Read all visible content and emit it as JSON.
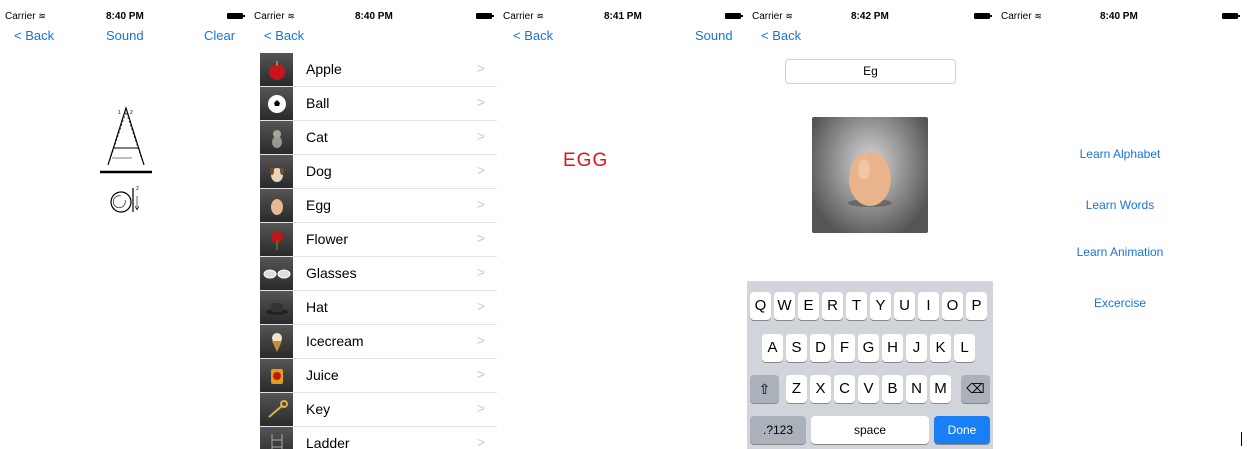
{
  "screens": [
    {
      "status": {
        "carrier": "Carrier",
        "time": "8:40 PM"
      },
      "nav": {
        "back": "< Back",
        "sound": "Sound",
        "clear": "Clear"
      }
    },
    {
      "status": {
        "carrier": "Carrier",
        "time": "8:40 PM"
      },
      "nav": {
        "back": "< Back"
      },
      "list": [
        "Apple",
        "Ball",
        "Cat",
        "Dog",
        "Egg",
        "Flower",
        "Glasses",
        "Hat",
        "Icecream",
        "Juice",
        "Key",
        "Ladder"
      ],
      "chevron": ">"
    },
    {
      "status": {
        "carrier": "Carrier",
        "time": "8:41 PM"
      },
      "nav": {
        "back": "< Back",
        "sound": "Sound"
      },
      "word": "EGG"
    },
    {
      "status": {
        "carrier": "Carrier",
        "time": "8:42 PM"
      },
      "nav": {
        "back": "< Back"
      },
      "input_value": "Eg",
      "keyboard": {
        "row1": [
          "Q",
          "W",
          "E",
          "R",
          "T",
          "Y",
          "U",
          "I",
          "O",
          "P"
        ],
        "row2": [
          "A",
          "S",
          "D",
          "F",
          "G",
          "H",
          "J",
          "K",
          "L"
        ],
        "row3": [
          "Z",
          "X",
          "C",
          "V",
          "B",
          "N",
          "M"
        ],
        "numbers": ".?123",
        "space": "space",
        "done": "Done"
      }
    },
    {
      "status": {
        "carrier": "Carrier",
        "time": "8:40 PM"
      },
      "menu": [
        "Learn Alphabet",
        "Learn Words",
        "Learn Animation",
        "Excercise"
      ]
    }
  ],
  "colors": {
    "link": "#1a73d9",
    "word": "#e0151c",
    "done": "#1a7ef5"
  }
}
